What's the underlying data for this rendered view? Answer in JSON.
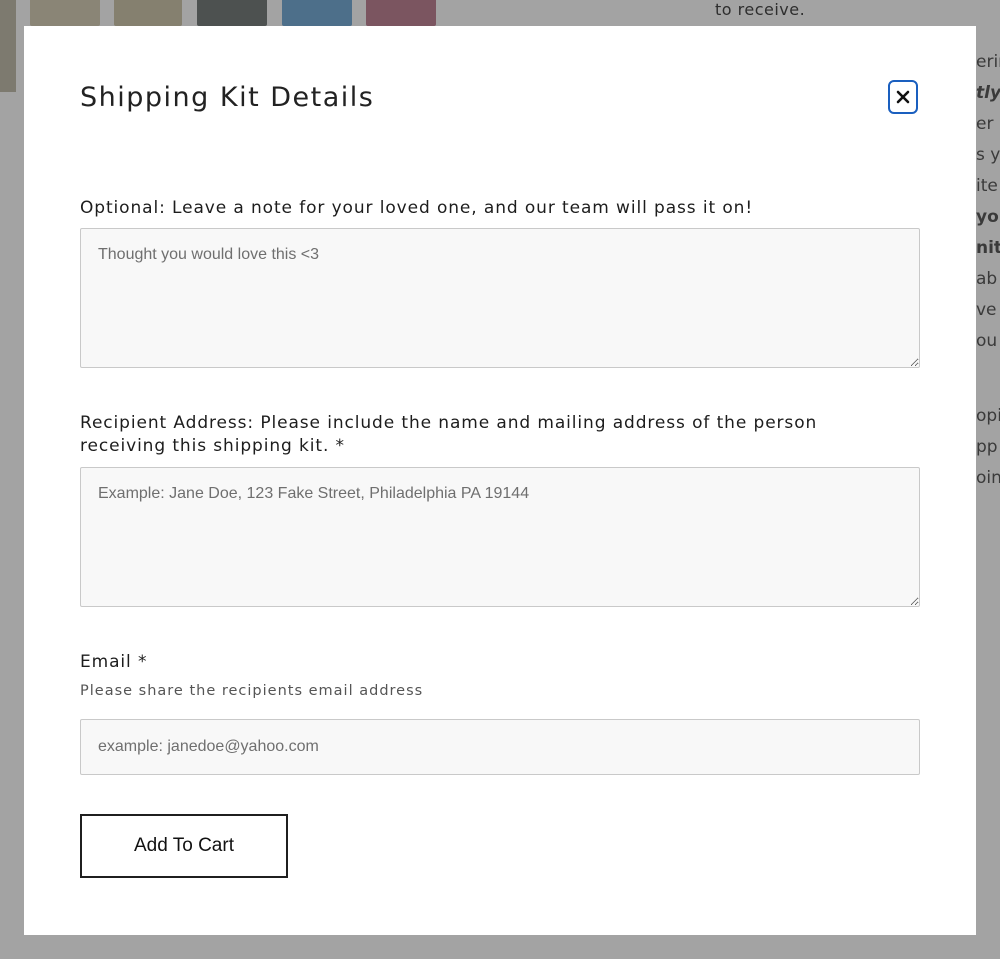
{
  "background": {
    "right_text": "to receive.",
    "side_fragments": [
      "erir",
      "tly",
      "er b",
      "s y",
      "ite",
      "you",
      "nit",
      "ab",
      "ve",
      "ou",
      "opi",
      "pp",
      "oin"
    ]
  },
  "modal": {
    "title": "Shipping Kit Details",
    "close_label": "close",
    "note": {
      "label": "Optional: Leave a note for your loved one, and our team will pass it on!",
      "placeholder": "Thought you would love this <3"
    },
    "address": {
      "label": "Recipient Address: Please include the name and mailing address of the person receiving this shipping kit. *",
      "placeholder": "Example: Jane Doe, 123 Fake Street, Philadelphia PA 19144"
    },
    "email": {
      "label": "Email *",
      "sublabel": "Please share the recipients email address",
      "placeholder": "example: janedoe@yahoo.com"
    },
    "submit_label": "Add To Cart"
  },
  "colors": {
    "overlay": "#9a9a9a",
    "modal_bg": "#ffffff",
    "focus_ring": "#1a5fbf",
    "input_bg": "#f8f8f8"
  }
}
